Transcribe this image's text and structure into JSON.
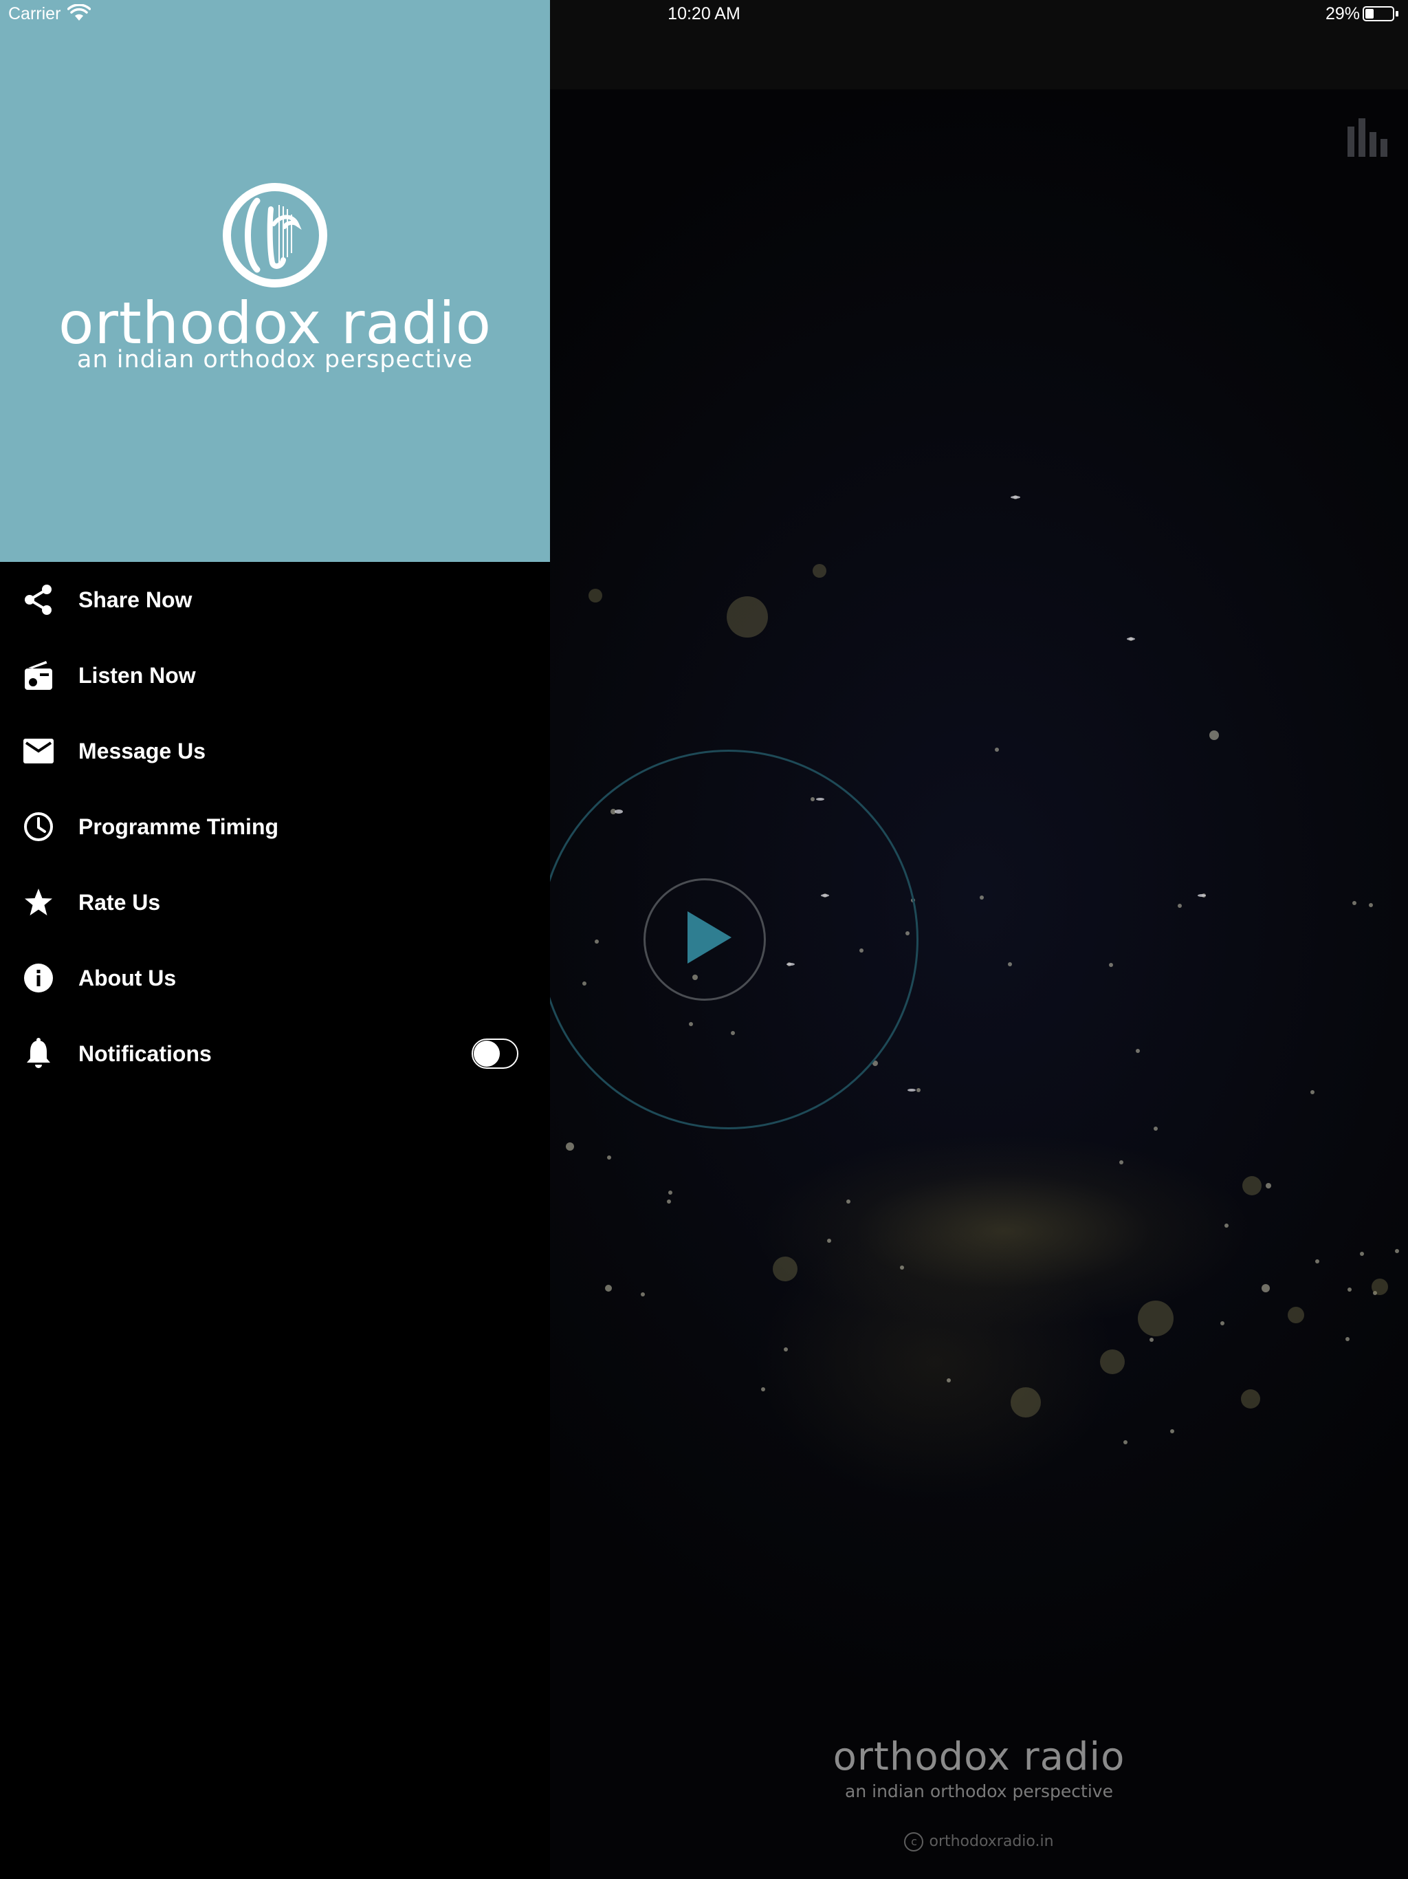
{
  "status_bar": {
    "carrier": "Carrier",
    "time": "10:20 AM",
    "battery": "29%",
    "wifi_icon": "wifi-icon",
    "battery_icon": "battery-icon"
  },
  "drawer": {
    "header_color": "#7ab2be",
    "logo": {
      "title": "orthodox radio",
      "tagline": "an indian orthodox perspective"
    },
    "menu": [
      {
        "label": "Share Now",
        "icon": "share-icon"
      },
      {
        "label": "Listen Now",
        "icon": "radio-icon"
      },
      {
        "label": "Message Us",
        "icon": "mail-icon"
      },
      {
        "label": "Programme Timing",
        "icon": "clock-icon"
      },
      {
        "label": "Rate Us",
        "icon": "star-icon"
      },
      {
        "label": "About Us",
        "icon": "info-icon"
      },
      {
        "label": "Notifications",
        "icon": "bell-icon",
        "toggle": false
      }
    ]
  },
  "player": {
    "brand_title": "orthodox radio",
    "brand_tagline": "an indian orthodox perspective",
    "copyright": "orthodoxradio.in",
    "accent_color": "#2f7e91",
    "icons": [
      "equalizer-icon",
      "play-icon",
      "copyright-icon"
    ]
  }
}
